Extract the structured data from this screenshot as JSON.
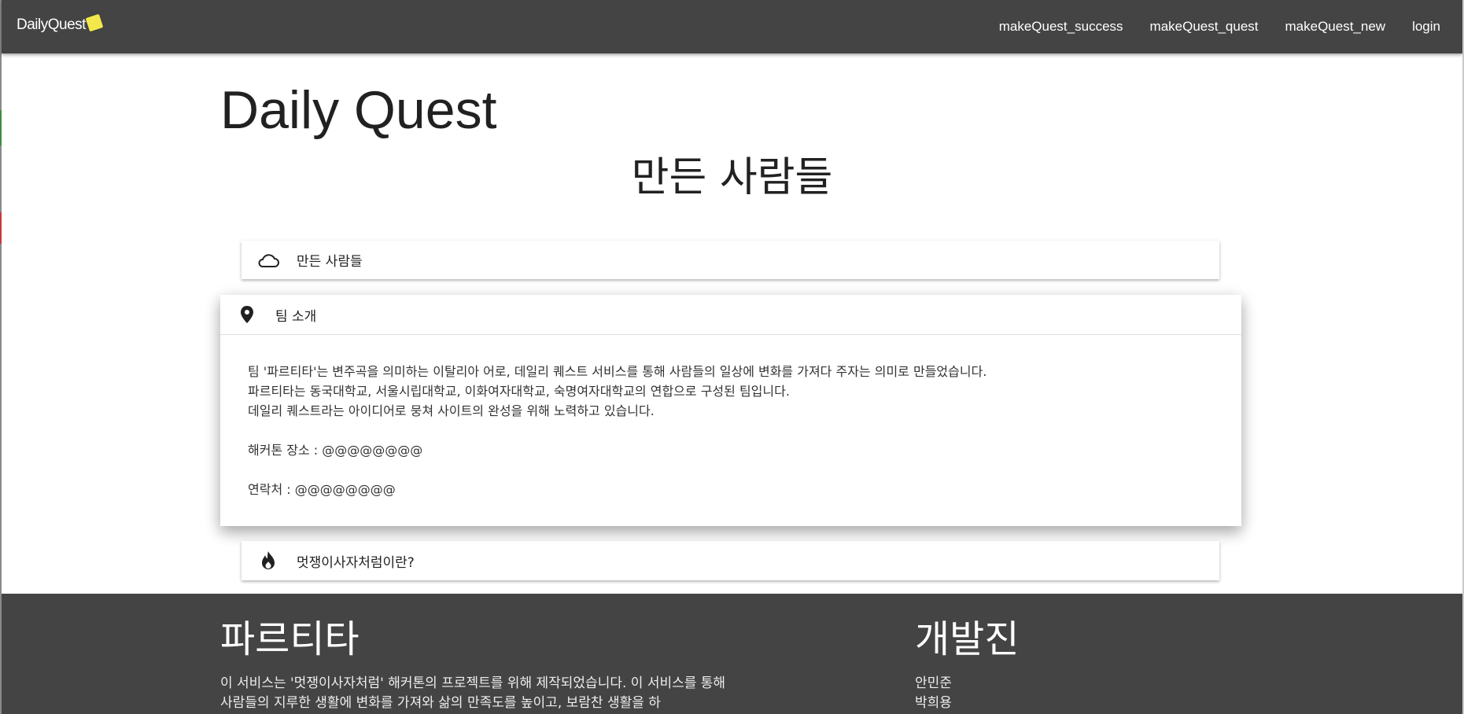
{
  "navbar": {
    "logo_text": "DailyQuest",
    "links": [
      {
        "label": "makeQuest_success"
      },
      {
        "label": "makeQuest_quest"
      },
      {
        "label": "makeQuest_new"
      },
      {
        "label": "login"
      }
    ]
  },
  "main": {
    "site_title": "Daily Quest",
    "section_heading": "만든 사람들",
    "items": [
      {
        "label": "만든 사람들",
        "icon": "cloud-icon"
      },
      {
        "label": "팀 소개",
        "icon": "location-pin-icon",
        "body": {
          "line1": "팀 '파르티타'는 변주곡을 의미하는 이탈리아 어로, 데일리 퀘스트 서비스를 통해 사람들의 일상에 변화를 가져다 주자는 의미로 만들었습니다.",
          "line2": "파르티타는 동국대학교, 서울시립대학교, 이화여자대학교, 숙명여자대학교의 연합으로 구성된 팀입니다.",
          "line3": "데일리 퀘스트라는 아이디어로 뭉쳐 사이트의 완성을 위해 노력하고 있습니다.",
          "location": "해커톤 장소 : @@@@@@@@",
          "contact": "연락처 : @@@@@@@@"
        }
      },
      {
        "label": "멋쟁이사자처럼이란?",
        "icon": "flame-icon"
      }
    ]
  },
  "footer": {
    "title": "파르티타",
    "text": "이 서비스는 '멋쟁이사자처럼' 해커톤의 프로젝트를 위해 제작되었습니다. 이 서비스를 통해 사람들의 지루한 생활에 변화를 가져와 삶의 만족도를 높이고, 보람찬 생활을 하",
    "dev_title": "개발진",
    "developers": [
      "안민준",
      "박희용"
    ]
  },
  "colors": {
    "navbar_bg": "#444444",
    "footer_bg": "#444444",
    "logo_badge": "#f3e84b"
  }
}
